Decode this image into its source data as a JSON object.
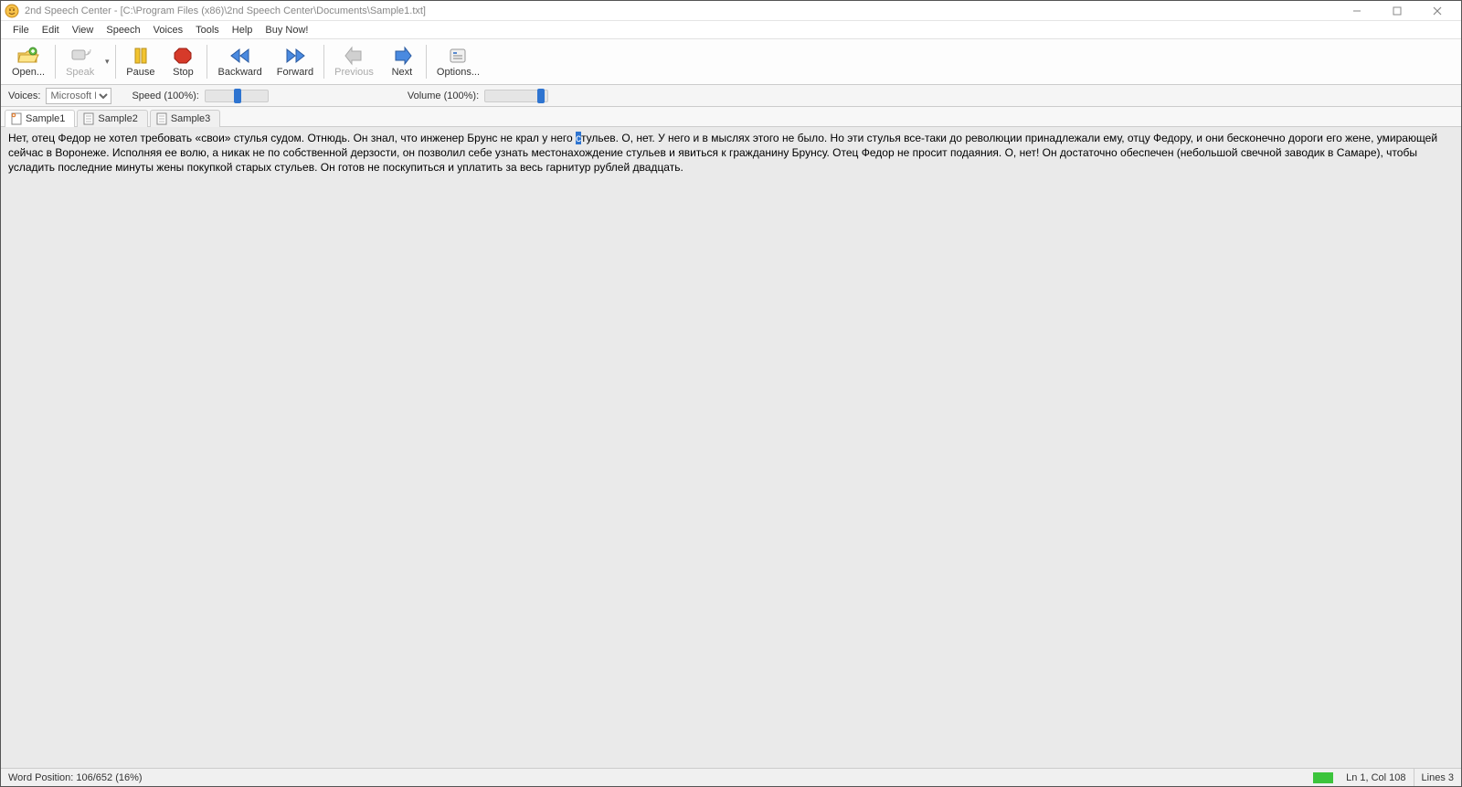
{
  "title": "2nd Speech Center - [C:\\Program Files (x86)\\2nd Speech Center\\Documents\\Sample1.txt]",
  "menubar": [
    "File",
    "Edit",
    "View",
    "Speech",
    "Voices",
    "Tools",
    "Help",
    "Buy Now!"
  ],
  "toolbar": {
    "open": "Open...",
    "speak": "Speak",
    "pause": "Pause",
    "stop": "Stop",
    "backward": "Backward",
    "forward": "Forward",
    "previous": "Previous",
    "next": "Next",
    "options": "Options..."
  },
  "controls": {
    "voices_label": "Voices:",
    "voice_selected": "Microsoft Irina D",
    "speed_label": "Speed (100%):",
    "speed_pos_pct": 50,
    "volume_label": "Volume (100%):",
    "volume_pos_pct": 92
  },
  "tabs": [
    {
      "label": "Sample1",
      "active": true,
      "modified": true
    },
    {
      "label": "Sample2",
      "active": false,
      "modified": false
    },
    {
      "label": "Sample3",
      "active": false,
      "modified": false
    }
  ],
  "document": {
    "pre_highlight": "Нет, отец Федор не хотел требовать «свои» стулья судом. Отнюдь. Он знал, что инженер Брунс не крал у него ",
    "highlight": "с",
    "post_highlight": "тульев. О, нет. У него и в мыслях этого не было. Но эти стулья все-таки до революции принадлежали ему, отцу Федору, и они бесконечно дороги его жене, умирающей сейчас в Воронеже. Исполняя ее волю, а никак не по собственной дерзости, он позволил себе узнать местонахождение стульев и явиться к гражданину Брунсу. Отец Федор не просит подаяния. О, нет! Он достаточно обеспечен (небольшой свечной заводик в Самаре), чтобы усладить последние минуты жены покупкой старых стульев. Он готов не поскупиться и уплатить за весь гарнитур рублей двадцать."
  },
  "status": {
    "word_position": "Word Position: 106/652 (16%)",
    "ln_col": "Ln 1, Col 108",
    "lines": "Lines 3"
  }
}
